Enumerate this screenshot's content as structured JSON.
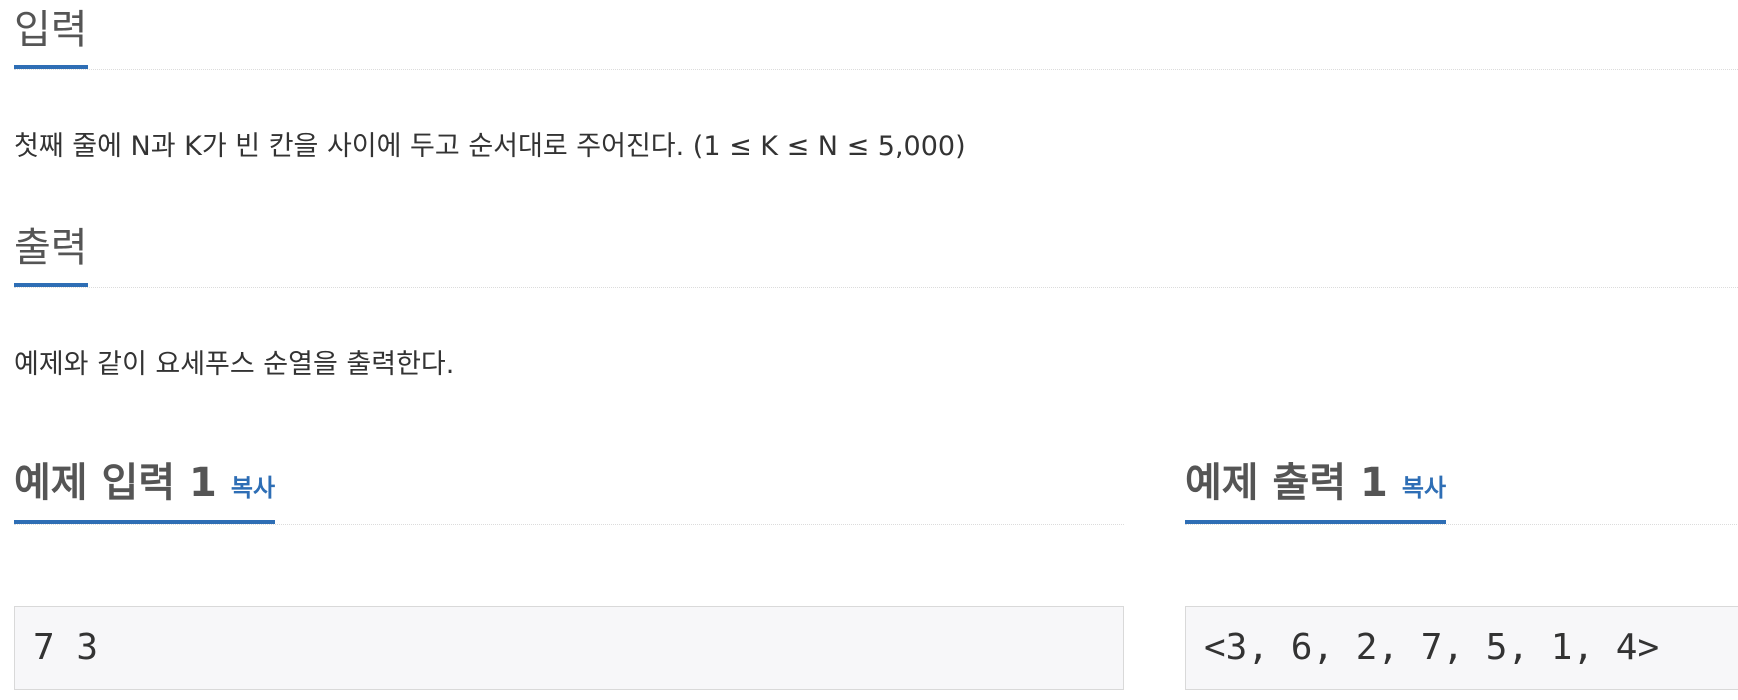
{
  "sections": {
    "input": {
      "title": "입력",
      "body": "첫째 줄에 N과 K가 빈 칸을 사이에 두고 순서대로 주어진다. (1 ≤ K ≤ N ≤ 5,000)"
    },
    "output": {
      "title": "출력",
      "body": "예제와 같이 요세푸스 순열을 출력한다."
    }
  },
  "samples": {
    "input": {
      "title": "예제 입력 1",
      "copy_label": "복사",
      "content": "7 3"
    },
    "output": {
      "title": "예제 출력 1",
      "copy_label": "복사",
      "content": "<3, 6, 2, 7, 5, 1, 4>"
    }
  },
  "colors": {
    "accent": "#2e6eb5",
    "heading": "#555555",
    "text": "#333333",
    "code_bg": "#f7f7f9",
    "code_border": "#d9d9d9"
  }
}
